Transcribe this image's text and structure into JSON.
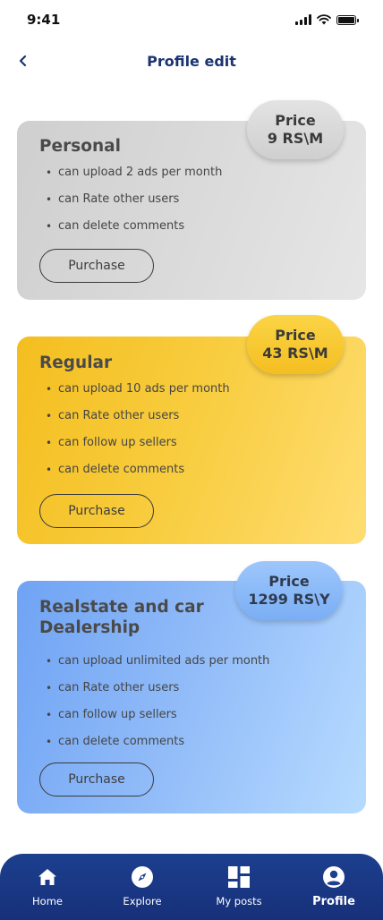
{
  "status_bar": {
    "time": "9:41"
  },
  "header": {
    "title": "Profile edit",
    "back_icon": "chevron-left-icon"
  },
  "plans": {
    "personal": {
      "title": "Personal",
      "price_label": "Price",
      "price_value": "9 RS\\M",
      "features": [
        "can upload 2 ads per month",
        "can Rate other users",
        "can delete comments"
      ],
      "button_label": "Purchase"
    },
    "regular": {
      "title": "Regular",
      "price_label": "Price",
      "price_value": "43 RS\\M",
      "features": [
        "can upload 10 ads per month",
        "can Rate other users",
        "can follow up sellers",
        "can delete comments"
      ],
      "button_label": "Purchase"
    },
    "dealer": {
      "title_line1": "Realstate and car",
      "title_line2": "Dealership",
      "price_label": "Price",
      "price_value": "1299 RS\\Y",
      "features": [
        "can upload unlimited ads per month",
        "can Rate other users",
        "can follow up sellers",
        "can delete comments"
      ],
      "button_label": "Purchase"
    }
  },
  "bottom_nav": {
    "items": [
      {
        "label": "Home",
        "icon": "home-icon"
      },
      {
        "label": "Explore",
        "icon": "compass-icon"
      },
      {
        "label": "My posts",
        "icon": "grid-icon"
      },
      {
        "label": "Profile",
        "icon": "user-circle-icon"
      }
    ],
    "active": "Profile"
  },
  "colors": {
    "nav_background": "#1c3f8e",
    "title_color": "#1b3470",
    "personal_card": "#d9d9d9",
    "regular_card": "#f8cd40",
    "dealer_card": "#8fbaf8"
  }
}
